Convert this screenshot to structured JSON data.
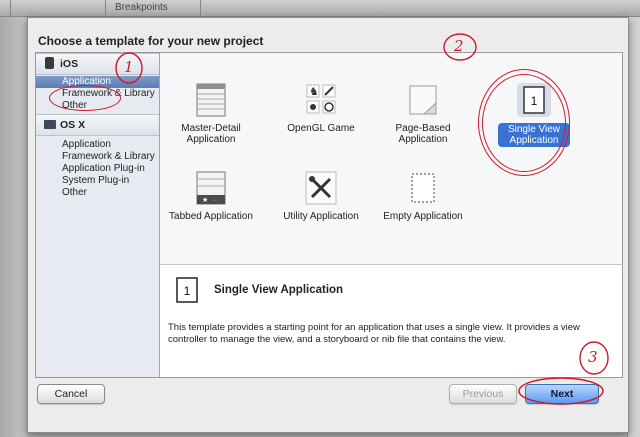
{
  "toolbar": {
    "breadcrumb": "Breakpoints"
  },
  "sheet": {
    "title": "Choose a template for your new project"
  },
  "sidebar": {
    "groups": [
      {
        "label": "iOS",
        "icon": "iphone-icon",
        "items": [
          {
            "label": "Application",
            "selected": true
          },
          {
            "label": "Framework & Library",
            "selected": false
          },
          {
            "label": "Other",
            "selected": false
          }
        ]
      },
      {
        "label": "OS X",
        "icon": "monitor-icon",
        "items": [
          {
            "label": "Application",
            "selected": false
          },
          {
            "label": "Framework & Library",
            "selected": false
          },
          {
            "label": "Application Plug-in",
            "selected": false
          },
          {
            "label": "System Plug-in",
            "selected": false
          },
          {
            "label": "Other",
            "selected": false
          }
        ]
      }
    ]
  },
  "templates": [
    {
      "label_line1": "Master-Detail",
      "label_line2": "Application",
      "icon": "master-detail-icon",
      "selected": false
    },
    {
      "label_line1": "OpenGL Game",
      "label_line2": "",
      "icon": "opengl-game-icon",
      "selected": false
    },
    {
      "label_line1": "Page-Based",
      "label_line2": "Application",
      "icon": "page-based-icon",
      "selected": false
    },
    {
      "label_line1": "Single View",
      "label_line2": "Application",
      "icon": "single-view-icon",
      "selected": true
    },
    {
      "label_line1": "Tabbed Application",
      "label_line2": "",
      "icon": "tabbed-app-icon",
      "selected": false
    },
    {
      "label_line1": "Utility Application",
      "label_line2": "",
      "icon": "utility-app-icon",
      "selected": false
    },
    {
      "label_line1": "Empty Application",
      "label_line2": "",
      "icon": "empty-app-icon",
      "selected": false
    }
  ],
  "detail": {
    "icon_glyph": "1",
    "title": "Single View Application",
    "description": "This template provides a starting point for an application that uses a single view. It provides a view controller to manage the view, and a storyboard or nib file that contains the view."
  },
  "buttons": {
    "cancel": "Cancel",
    "previous": "Previous",
    "next": "Next"
  },
  "annotations": {
    "one": "1",
    "two": "2",
    "three": "3"
  },
  "colors": {
    "annotation_red": "#d0192a",
    "selection_blue": "#3873d4",
    "sidebar_selected": "#6a89bd"
  }
}
